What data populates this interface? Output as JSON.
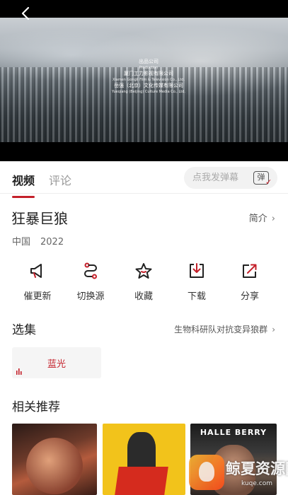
{
  "player": {
    "credits": {
      "line1": "出品公司",
      "line2": "Production",
      "line3": "厦门工力影视有限公司",
      "line4": "Xiamen Gongli Film & Television Co., Ltd.",
      "line5": "岳强（北京）文化传媒有限公司",
      "line6": "Yueqiang (Beijing) Culture Media Co., Ltd."
    }
  },
  "tabs": [
    {
      "label": "视频",
      "active": true
    },
    {
      "label": "评论",
      "active": false
    }
  ],
  "danmu": {
    "placeholder": "点我发弹幕",
    "toggle_label": "弹"
  },
  "movie": {
    "title": "狂暴巨狼",
    "intro_label": "简介",
    "region": "中国",
    "year": "2022"
  },
  "actions": [
    {
      "label": "催更新",
      "icon": "megaphone-icon"
    },
    {
      "label": "切换源",
      "icon": "switch-source-icon"
    },
    {
      "label": "收藏",
      "icon": "star-icon"
    },
    {
      "label": "下载",
      "icon": "download-icon"
    },
    {
      "label": "分享",
      "icon": "share-icon"
    }
  ],
  "episodes": {
    "heading": "选集",
    "series_link": "生物科研队对抗变异狼群",
    "items": [
      {
        "label": "蓝光",
        "selected": true
      }
    ]
  },
  "recommended": {
    "heading": "相关推荐",
    "posters": [
      {
        "text": ""
      },
      {
        "text": ""
      },
      {
        "text": "HALLE BERRY"
      }
    ]
  },
  "watermark": {
    "text": "鲸夏资源网",
    "url": "kuqe.com"
  },
  "colors": {
    "accent": "#c4202a",
    "muted_text": "#999999",
    "background": "#ffffff"
  }
}
